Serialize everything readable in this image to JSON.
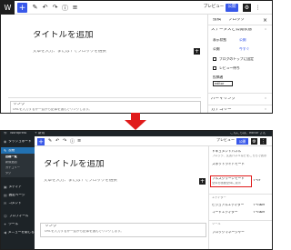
{
  "top": {
    "toolbar": {
      "plus": "+",
      "preview": "プレビュー",
      "publish": "公開"
    },
    "editor": {
      "title_placeholder": "タイトルを追加",
      "block_hint": "文章を入力、または / でブロックを選択"
    },
    "sidebar": {
      "tabs": [
        "投稿",
        "ブロック"
      ],
      "status_heading": "ステータスと公開状態",
      "rows": [
        {
          "label": "表示状態",
          "value": "公開"
        },
        {
          "label": "公開",
          "value": "今すぐ"
        }
      ],
      "checkboxes": [
        "ブログのトップに固定",
        "レビュー待ち"
      ],
      "author_label": "投稿者",
      "author_value": "editor",
      "sections": [
        "パーマリンク",
        "カテゴリー"
      ]
    },
    "card": {
      "title": "リンク",
      "desc": "URLを入力するか一覧から記事を選んでリンクします。"
    }
  },
  "bottom": {
    "adminbar": {
      "site": "Wordpress",
      "new": "+ 新規",
      "greeting": "こんにちは、editor さん"
    },
    "menu": [
      {
        "icon": "◉",
        "label": "ダッシュボード"
      },
      {
        "icon": "✎",
        "label": "投稿"
      },
      {
        "icon": "▣",
        "label": "メディア"
      },
      {
        "icon": "▤",
        "label": "固定ページ"
      },
      {
        "icon": "✉",
        "label": "コメント"
      },
      {
        "icon": "☺",
        "label": "プロフィール"
      },
      {
        "icon": "✦",
        "label": "ツール"
      },
      {
        "icon": "◀",
        "label": "メニューを閉じる"
      }
    ],
    "submenu": [
      "投稿一覧",
      "新規追加",
      "カテゴリー",
      "タグ"
    ],
    "toolbar": {
      "plus": "+",
      "preview": "プレビュー",
      "publish": "公開"
    },
    "editor": {
      "title_placeholder": "タイトルを追加",
      "block_hint": "文章を入力、または / でブロックを選択"
    },
    "card": {
      "title": "リンク",
      "desc": "URLを入力するか一覧から記事を選んでリンクします。"
    },
    "sidebar": {
      "section1": "ドキュメントパネル",
      "section1_desc": "ブロック、文書パネルなどをこちらで表示",
      "section2": "スポットライトモード",
      "highlight_label": "フルスクリーンモード",
      "highlight_desc": "全体を画面全体に表示",
      "highlight_shortcut": "⇧⌥F",
      "section3": "エディター",
      "editor_rows": [
        {
          "label": "ビジュアルエディター",
          "shortcut": "⇧⌥⌘M"
        },
        {
          "label": "コードエディター",
          "shortcut": "⇧⌥⌘M"
        }
      ],
      "section4": "ツール",
      "tools_row": "ブロックマネージャー"
    }
  }
}
